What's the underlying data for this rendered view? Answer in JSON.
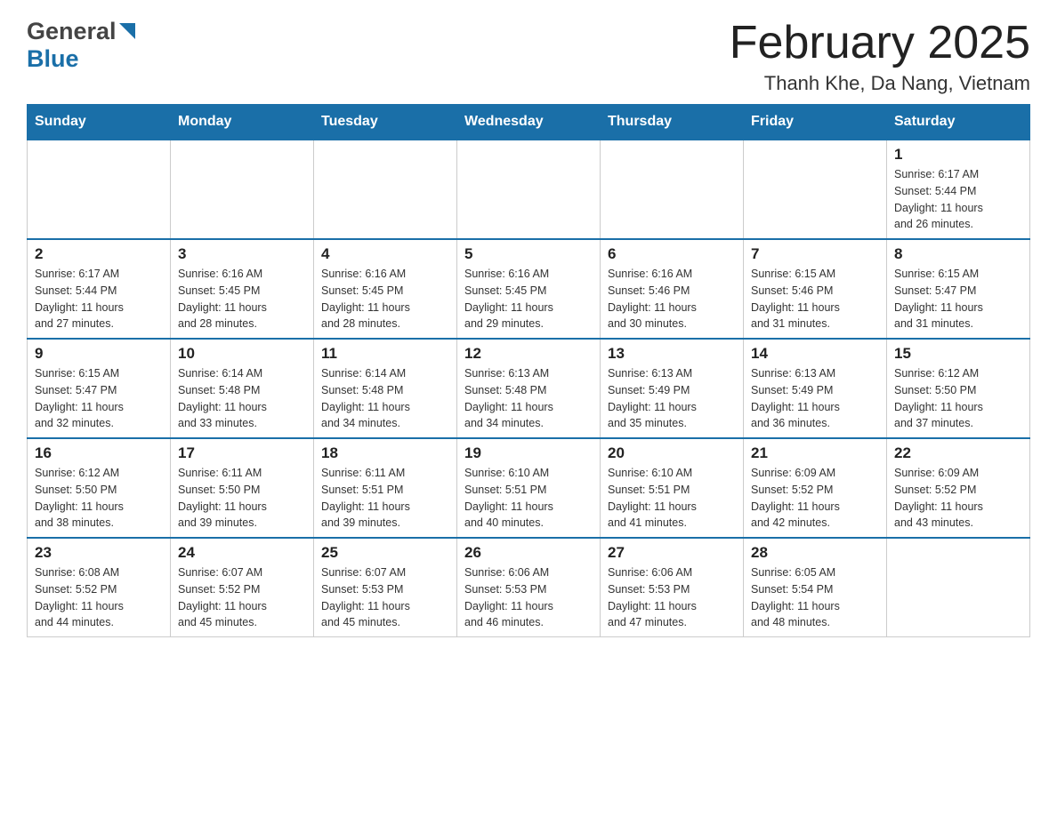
{
  "header": {
    "month_title": "February 2025",
    "location": "Thanh Khe, Da Nang, Vietnam",
    "logo_general": "General",
    "logo_blue": "Blue"
  },
  "days_of_week": [
    "Sunday",
    "Monday",
    "Tuesday",
    "Wednesday",
    "Thursday",
    "Friday",
    "Saturday"
  ],
  "weeks": [
    {
      "days": [
        {
          "number": "",
          "info": ""
        },
        {
          "number": "",
          "info": ""
        },
        {
          "number": "",
          "info": ""
        },
        {
          "number": "",
          "info": ""
        },
        {
          "number": "",
          "info": ""
        },
        {
          "number": "",
          "info": ""
        },
        {
          "number": "1",
          "info": "Sunrise: 6:17 AM\nSunset: 5:44 PM\nDaylight: 11 hours\nand 26 minutes."
        }
      ]
    },
    {
      "days": [
        {
          "number": "2",
          "info": "Sunrise: 6:17 AM\nSunset: 5:44 PM\nDaylight: 11 hours\nand 27 minutes."
        },
        {
          "number": "3",
          "info": "Sunrise: 6:16 AM\nSunset: 5:45 PM\nDaylight: 11 hours\nand 28 minutes."
        },
        {
          "number": "4",
          "info": "Sunrise: 6:16 AM\nSunset: 5:45 PM\nDaylight: 11 hours\nand 28 minutes."
        },
        {
          "number": "5",
          "info": "Sunrise: 6:16 AM\nSunset: 5:45 PM\nDaylight: 11 hours\nand 29 minutes."
        },
        {
          "number": "6",
          "info": "Sunrise: 6:16 AM\nSunset: 5:46 PM\nDaylight: 11 hours\nand 30 minutes."
        },
        {
          "number": "7",
          "info": "Sunrise: 6:15 AM\nSunset: 5:46 PM\nDaylight: 11 hours\nand 31 minutes."
        },
        {
          "number": "8",
          "info": "Sunrise: 6:15 AM\nSunset: 5:47 PM\nDaylight: 11 hours\nand 31 minutes."
        }
      ]
    },
    {
      "days": [
        {
          "number": "9",
          "info": "Sunrise: 6:15 AM\nSunset: 5:47 PM\nDaylight: 11 hours\nand 32 minutes."
        },
        {
          "number": "10",
          "info": "Sunrise: 6:14 AM\nSunset: 5:48 PM\nDaylight: 11 hours\nand 33 minutes."
        },
        {
          "number": "11",
          "info": "Sunrise: 6:14 AM\nSunset: 5:48 PM\nDaylight: 11 hours\nand 34 minutes."
        },
        {
          "number": "12",
          "info": "Sunrise: 6:13 AM\nSunset: 5:48 PM\nDaylight: 11 hours\nand 34 minutes."
        },
        {
          "number": "13",
          "info": "Sunrise: 6:13 AM\nSunset: 5:49 PM\nDaylight: 11 hours\nand 35 minutes."
        },
        {
          "number": "14",
          "info": "Sunrise: 6:13 AM\nSunset: 5:49 PM\nDaylight: 11 hours\nand 36 minutes."
        },
        {
          "number": "15",
          "info": "Sunrise: 6:12 AM\nSunset: 5:50 PM\nDaylight: 11 hours\nand 37 minutes."
        }
      ]
    },
    {
      "days": [
        {
          "number": "16",
          "info": "Sunrise: 6:12 AM\nSunset: 5:50 PM\nDaylight: 11 hours\nand 38 minutes."
        },
        {
          "number": "17",
          "info": "Sunrise: 6:11 AM\nSunset: 5:50 PM\nDaylight: 11 hours\nand 39 minutes."
        },
        {
          "number": "18",
          "info": "Sunrise: 6:11 AM\nSunset: 5:51 PM\nDaylight: 11 hours\nand 39 minutes."
        },
        {
          "number": "19",
          "info": "Sunrise: 6:10 AM\nSunset: 5:51 PM\nDaylight: 11 hours\nand 40 minutes."
        },
        {
          "number": "20",
          "info": "Sunrise: 6:10 AM\nSunset: 5:51 PM\nDaylight: 11 hours\nand 41 minutes."
        },
        {
          "number": "21",
          "info": "Sunrise: 6:09 AM\nSunset: 5:52 PM\nDaylight: 11 hours\nand 42 minutes."
        },
        {
          "number": "22",
          "info": "Sunrise: 6:09 AM\nSunset: 5:52 PM\nDaylight: 11 hours\nand 43 minutes."
        }
      ]
    },
    {
      "days": [
        {
          "number": "23",
          "info": "Sunrise: 6:08 AM\nSunset: 5:52 PM\nDaylight: 11 hours\nand 44 minutes."
        },
        {
          "number": "24",
          "info": "Sunrise: 6:07 AM\nSunset: 5:52 PM\nDaylight: 11 hours\nand 45 minutes."
        },
        {
          "number": "25",
          "info": "Sunrise: 6:07 AM\nSunset: 5:53 PM\nDaylight: 11 hours\nand 45 minutes."
        },
        {
          "number": "26",
          "info": "Sunrise: 6:06 AM\nSunset: 5:53 PM\nDaylight: 11 hours\nand 46 minutes."
        },
        {
          "number": "27",
          "info": "Sunrise: 6:06 AM\nSunset: 5:53 PM\nDaylight: 11 hours\nand 47 minutes."
        },
        {
          "number": "28",
          "info": "Sunrise: 6:05 AM\nSunset: 5:54 PM\nDaylight: 11 hours\nand 48 minutes."
        },
        {
          "number": "",
          "info": ""
        }
      ]
    }
  ]
}
